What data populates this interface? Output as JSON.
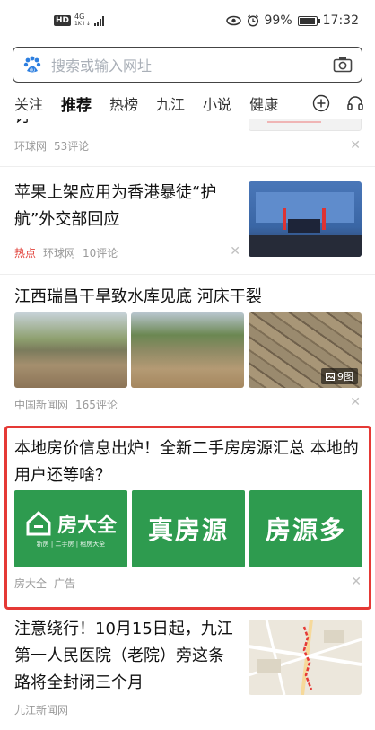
{
  "status_bar": {
    "hd_label": "HD",
    "network_top": "4G",
    "network_bottom": "1K↑↓",
    "battery_percent": "99%",
    "battery_level": 0.99,
    "time": "17:32"
  },
  "search": {
    "placeholder": "搜索或输入网址"
  },
  "tabs": [
    {
      "label": "关注"
    },
    {
      "label": "推荐"
    },
    {
      "label": "热榜"
    },
    {
      "label": "九江"
    },
    {
      "label": "小说"
    },
    {
      "label": "健康"
    }
  ],
  "feed": {
    "partial_item": {
      "title_tail": "讨",
      "source": "环球网",
      "comments": "53评论"
    },
    "item1": {
      "title": "苹果上架应用为香港暴徒“护航”外交部回应",
      "tag": "热点",
      "source": "环球网",
      "comments": "10评论"
    },
    "item2": {
      "title": "江西瑞昌干旱致水库见底 河床干裂",
      "source": "中国新闻网",
      "comments": "165评论",
      "image_count": "9图"
    },
    "ad": {
      "title": "本地房价信息出炉！全新二手房房源汇总 本地的用户还等啥？",
      "tiles": [
        {
          "label": "房大全",
          "sublabel": "新房 | 二手房 | 租房大全"
        },
        {
          "label": "真房源"
        },
        {
          "label": "房源多"
        }
      ],
      "source": "房大全",
      "ad_label": "广告"
    },
    "item3": {
      "title": "注意绕行！10月15日起，九江第一人民医院（老院）旁这条路将全封闭三个月",
      "source": "九江新闻网"
    }
  }
}
